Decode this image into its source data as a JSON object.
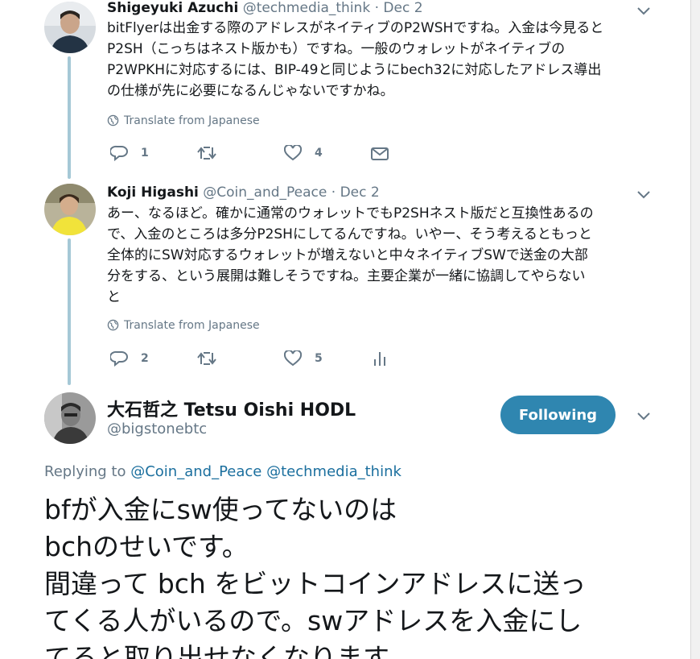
{
  "tweets": [
    {
      "name": "Shigeyuki Azuchi",
      "handle": "@techmedia_think",
      "dot": "·",
      "date": "Dec 2",
      "lines": [
        "bitFlyerは出金する際のアドレスがネイティブのP2WSHですね。入金は今見ると",
        "P2SH（こっちはネスト版かも）ですね。一般のウォレットがネイティブの",
        "P2WPKHに対応するには、BIP-49と同じようにbech32に対応したアドレス導出",
        "の仕様が先に必要になるんじゃないですかね。"
      ],
      "translate": "Translate from Japanese",
      "reply_count": "1",
      "retweet_count": "",
      "like_count": "4"
    },
    {
      "name": "Koji Higashi",
      "handle": "@Coin_and_Peace",
      "dot": "·",
      "date": "Dec 2",
      "lines": [
        "あー、なるほど。確かに通常のウォレットでもP2SHネスト版だと互換性あるの",
        "で、入金のところは多分P2SHにしてるんですね。いやー、そう考えるともっと",
        "全体的にSW対応するウォレットが増えないと中々ネイティブSWで送金の大部",
        "分をする、という展開は難しそうですね。主要企業が一緒に協調してやらない",
        "と"
      ],
      "translate": "Translate from Japanese",
      "reply_count": "2",
      "retweet_count": "",
      "like_count": "5"
    }
  ],
  "main": {
    "name": "大石哲之 Tetsu Oishi HODL",
    "handle": "@bigstonebtc",
    "follow_label": "Following",
    "replying_prefix": "Replying to",
    "replying_to_1": "@Coin_and_Peace",
    "replying_to_2": "@techmedia_think",
    "lines": [
      "bfが入金にsw使ってないのは",
      "bchのせいです。",
      "間違って bch をビットコインアドレスに送っ",
      "てくる人がいるので。swアドレスを入金にし",
      "てると取り出せなくなります"
    ]
  },
  "colors": {
    "accent": "#2f86b0",
    "link": "#1b6f9e",
    "muted": "#657786",
    "thread_line": "#a5c8d6"
  },
  "icons": [
    "reply-icon",
    "retweet-icon",
    "like-icon",
    "dm-icon",
    "analytics-icon",
    "globe-icon",
    "chevron-down-icon"
  ]
}
